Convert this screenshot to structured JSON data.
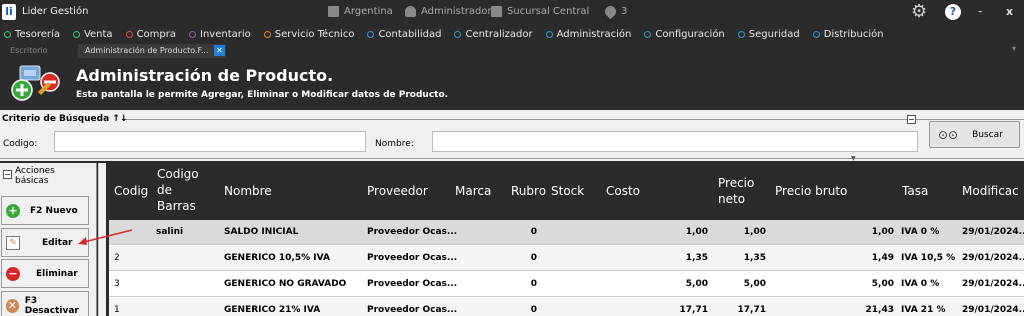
{
  "app": {
    "logo": "li",
    "title": "Lider Gestión"
  },
  "titlebar": {
    "country": "Argentina",
    "user": "Administrador",
    "branch": "Sucursal Central",
    "location_count": "3",
    "help": "?",
    "minimize": "-",
    "close": "x"
  },
  "menu": [
    {
      "label": "Tesorería",
      "color": "#2ecc71"
    },
    {
      "label": "Venta",
      "color": "#2ecc71"
    },
    {
      "label": "Compra",
      "color": "#e74c3c"
    },
    {
      "label": "Inventario",
      "color": "#9b59b6"
    },
    {
      "label": "Servicio Técnico",
      "color": "#e67e22"
    },
    {
      "label": "Contabilidad",
      "color": "#3498db"
    },
    {
      "label": "Centralizador",
      "color": "#3498db"
    },
    {
      "label": "Administración",
      "color": "#3498db"
    },
    {
      "label": "Configuración",
      "color": "#3498db"
    },
    {
      "label": "Seguridad",
      "color": "#3498db"
    },
    {
      "label": "Distribución",
      "color": "#3498db"
    }
  ],
  "tabs": {
    "desktop": "Escritorio",
    "active": "Administración de Producto.F...",
    "close": "✕"
  },
  "header": {
    "title": "Administración de Producto.",
    "subtitle": "Esta pantalla le permite Agregar, Eliminar o Modificar datos de Producto."
  },
  "search": {
    "legend": "Criterio de Búsqueda ↑↓",
    "code_label": "Codigo:",
    "code_value": "",
    "name_label": "Nombre:",
    "name_value": "",
    "button": "Buscar"
  },
  "actions": {
    "title_line1": "Acciones",
    "title_line2": "básicas",
    "buttons": [
      "F2 Nuevo",
      "Editar",
      "Eliminar",
      "F3 Desactivar"
    ]
  },
  "grid": {
    "headers": {
      "codigo": "Codig",
      "codigo_barras_1": "Codigo",
      "codigo_barras_2": "de",
      "codigo_barras_3": "Barras",
      "nombre": "Nombre",
      "proveedor": "Proveedor",
      "marca": "Marca",
      "rubro": "Rubro",
      "stock": "Stock",
      "costo": "Costo",
      "precio_neto_1": "Precio",
      "precio_neto_2": "neto",
      "precio_bruto": "Precio bruto",
      "tasa": "Tasa",
      "modificacion": "Modificac"
    },
    "rows": [
      {
        "codigo": "",
        "barras": "salini",
        "nombre": "SALDO INICIAL",
        "proveedor": "Proveedor Ocas...",
        "stock": "0",
        "costo": "1,00",
        "neto": "1,00",
        "bruto": "1,00",
        "tasa": "IVA 0 %",
        "mod": "29/01/2024..."
      },
      {
        "codigo": "2",
        "barras": "",
        "nombre": "GENERICO 10,5% IVA",
        "proveedor": "Proveedor Ocas...",
        "stock": "0",
        "costo": "1,35",
        "neto": "1,35",
        "bruto": "1,49",
        "tasa": "IVA 10,5 %",
        "mod": "29/01/2024..."
      },
      {
        "codigo": "3",
        "barras": "",
        "nombre": "GENERICO NO GRAVADO",
        "proveedor": "Proveedor Ocas...",
        "stock": "0",
        "costo": "5,00",
        "neto": "5,00",
        "bruto": "5,00",
        "tasa": "IVA 0 %",
        "mod": "29/01/2024..."
      },
      {
        "codigo": "1",
        "barras": "",
        "nombre": "GENERICO 21% IVA",
        "proveedor": "Proveedor Ocas...",
        "stock": "0",
        "costo": "17,71",
        "neto": "17,71",
        "bruto": "21,43",
        "tasa": "IVA 21 %",
        "mod": "29/01/2024..."
      }
    ]
  }
}
